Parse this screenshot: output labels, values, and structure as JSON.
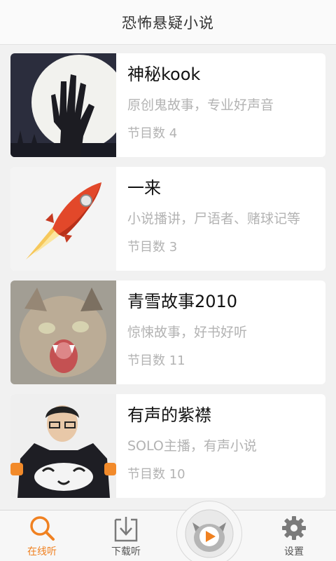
{
  "header": {
    "title": "恐怖悬疑小说"
  },
  "albums": [
    {
      "title": "神秘kook",
      "desc": "原创鬼故事，专业好声音",
      "count": "节目数 4",
      "icon": "zombie-hand-moon"
    },
    {
      "title": "一来",
      "desc": "小说播讲，尸语者、赌球记等",
      "count": "节目数 3",
      "icon": "rocket"
    },
    {
      "title": "青雪故事2010",
      "desc": "惊悚故事，好书好听",
      "count": "节目数 11",
      "icon": "screaming-cat"
    },
    {
      "title": "有声的紫襟",
      "desc": "SOLO主播，有声小说",
      "count": "节目数 10",
      "icon": "person-with-cat-pillow"
    }
  ],
  "tabbar": {
    "tabs": [
      {
        "label": "在线听",
        "icon": "search-icon",
        "active": true
      },
      {
        "label": "下载听",
        "icon": "download-icon",
        "active": false
      },
      {
        "label": "",
        "icon": "play-icon",
        "active": false
      },
      {
        "label": "设置",
        "icon": "gear-icon",
        "active": false
      }
    ]
  },
  "colors": {
    "accent": "#f08121",
    "background": "#f1f1f1",
    "card": "#ffffff",
    "subtext": "#b3b3b3"
  }
}
